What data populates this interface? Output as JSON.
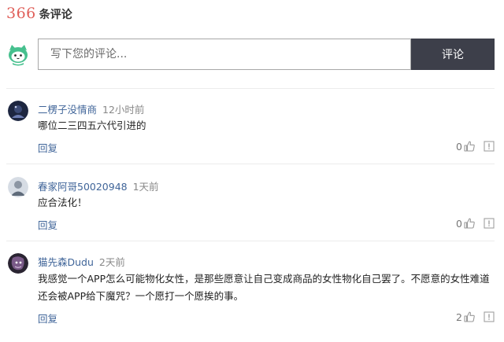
{
  "header": {
    "count": "366",
    "count_label": "条评论"
  },
  "composer": {
    "placeholder": "写下您的评论...",
    "submit_label": "评论",
    "avatar_icon": "cat-avatar-icon"
  },
  "comments": [
    {
      "username": "二楞子没情商",
      "time": "12小时前",
      "text": "哪位二三四五六代引进的",
      "reply_label": "回复",
      "likes": "0"
    },
    {
      "username": "春家阿哥50020948",
      "time": "1天前",
      "text": "应合法化！",
      "reply_label": "回复",
      "likes": "0"
    },
    {
      "username": "猫先森Dudu",
      "time": "2天前",
      "text": "我感觉一个APP怎么可能物化女性，是那些愿意让自己变成商品的女性物化自己罢了。不愿意的女性难道还会被APP给下魔咒？一个愿打一个愿挨的事。",
      "reply_label": "回复",
      "likes": "2"
    }
  ],
  "colors": {
    "accent_count": "#e0605a",
    "link": "#406599",
    "button_bg": "#3d3f4a",
    "cat_green": "#46c08e"
  }
}
